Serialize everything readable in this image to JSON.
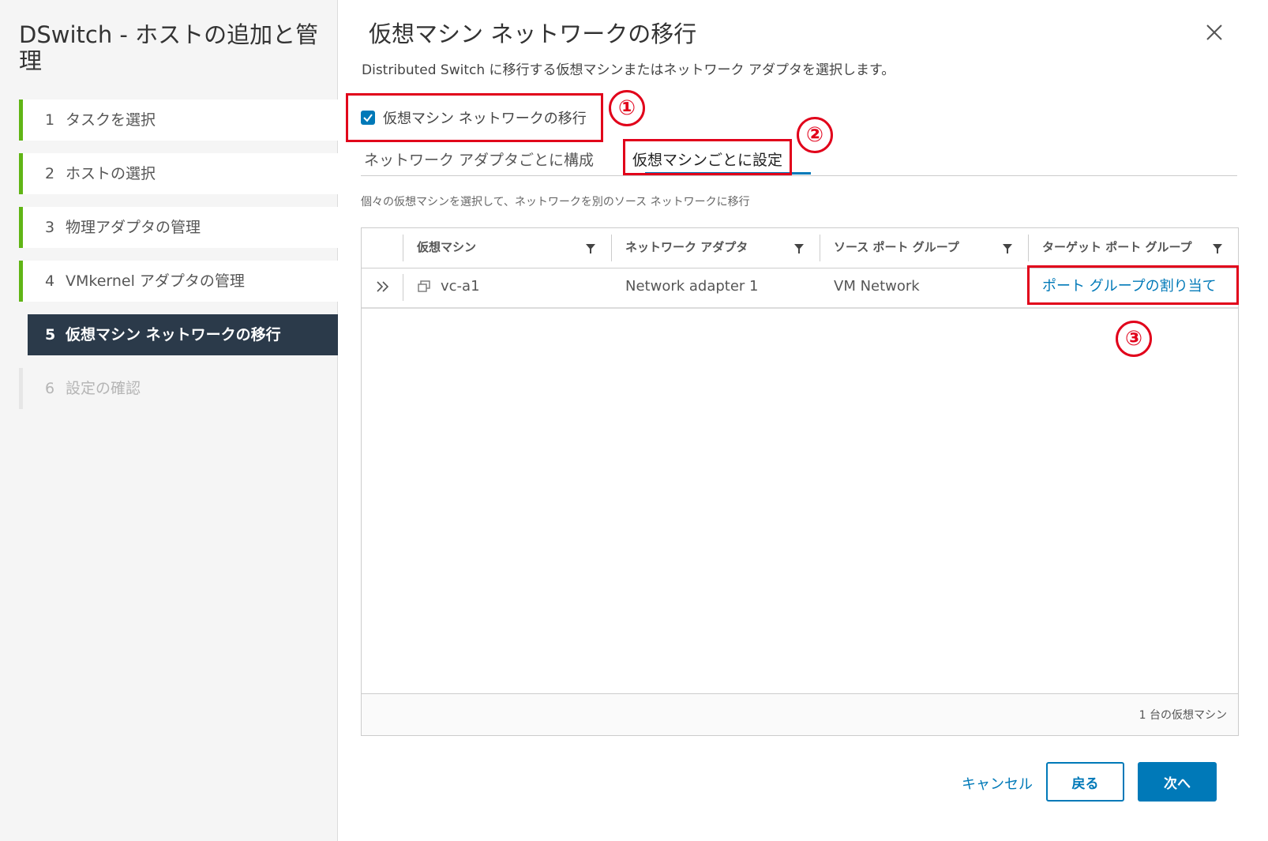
{
  "sidebar": {
    "title": "DSwitch - ホストの追加と管理",
    "steps": [
      {
        "num": "1",
        "label": "タスクを選択"
      },
      {
        "num": "2",
        "label": "ホストの選択"
      },
      {
        "num": "3",
        "label": "物理アダプタの管理"
      },
      {
        "num": "4",
        "label": "VMkernel アダプタの管理"
      },
      {
        "num": "5",
        "label": "仮想マシン ネットワークの移行"
      },
      {
        "num": "6",
        "label": "設定の確認"
      }
    ]
  },
  "dialog": {
    "title": "仮想マシン ネットワークの移行",
    "subtitle": "Distributed Switch に移行する仮想マシンまたはネットワーク アダプタを選択します。",
    "checkbox_label": "仮想マシン ネットワークの移行",
    "tabs": [
      {
        "label": "ネットワーク アダプタごとに構成"
      },
      {
        "label": "仮想マシンごとに設定"
      }
    ],
    "description": "個々の仮想マシンを選択して、ネットワークを別のソース ネットワークに移行"
  },
  "grid": {
    "columns": [
      "仮想マシン",
      "ネットワーク アダプタ",
      "ソース ポート グループ",
      "ターゲット ポート グループ"
    ],
    "rows": [
      {
        "vm": "vc-a1",
        "adapter": "Network adapter 1",
        "source": "VM Network",
        "target": "ポート グループの割り当て"
      }
    ],
    "footer": "1 台の仮想マシン"
  },
  "annotations": {
    "m1": "①",
    "m2": "②",
    "m3": "③"
  },
  "buttons": {
    "cancel": "キャンセル",
    "back": "戻る",
    "next": "次へ"
  },
  "icons": {
    "close": "close-icon",
    "check": "checkmark-icon",
    "filter": "filter-icon",
    "expand": "double-chevron-right-icon",
    "vm": "vm-icon"
  },
  "colors": {
    "accent": "#0079b8",
    "progress": "#60b515",
    "active_step": "#2b3a4a",
    "annotation": "#e1001a"
  }
}
